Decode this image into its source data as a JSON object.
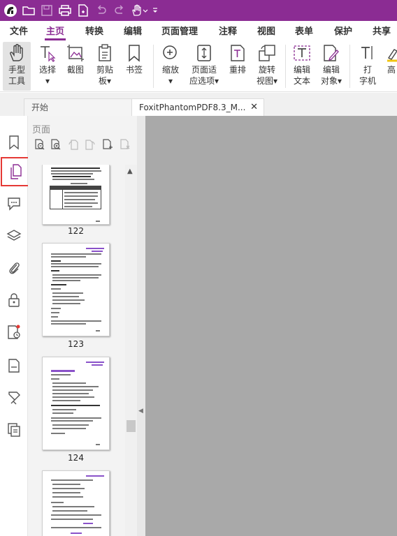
{
  "quick_access": {
    "icons": [
      "app-logo-icon",
      "open-folder-icon",
      "save-icon",
      "print-icon",
      "new-doc-icon",
      "undo-icon",
      "redo-icon",
      "hand-tool-icon",
      "customize-icon"
    ]
  },
  "ribbon_tabs": [
    "文件",
    "主页",
    "转换",
    "编辑",
    "页面管理",
    "注释",
    "视图",
    "表单",
    "保护",
    "共享"
  ],
  "active_tab": "主页",
  "ribbon_buttons": [
    {
      "label1": "手型",
      "label2": "工具"
    },
    {
      "label1": "选择",
      "label2": "▾"
    },
    {
      "label1": "截图",
      "label2": ""
    },
    {
      "label1": "剪贴",
      "label2": "板▾"
    },
    {
      "label1": "书签",
      "label2": ""
    },
    {
      "label1": "缩放",
      "label2": "▾"
    },
    {
      "label1": "页面适",
      "label2": "应选项▾"
    },
    {
      "label1": "重排",
      "label2": ""
    },
    {
      "label1": "旋转",
      "label2": "视图▾"
    },
    {
      "label1": "编辑",
      "label2": "文本"
    },
    {
      "label1": "编辑",
      "label2": "对象▾"
    },
    {
      "label1": "打",
      "label2": "字机"
    },
    {
      "label1": "高",
      "label2": ""
    }
  ],
  "doc_tabs": {
    "start_label": "开始",
    "current_label": "FoxitPhantomPDF8.3_M...",
    "close_symbol": "✕"
  },
  "panel": {
    "title": "页面",
    "page_numbers": [
      "122",
      "123",
      "124"
    ]
  },
  "colors": {
    "brand": "#8b2c93",
    "selection_outline": "#e53935",
    "document_background": "#a9a9a9"
  }
}
